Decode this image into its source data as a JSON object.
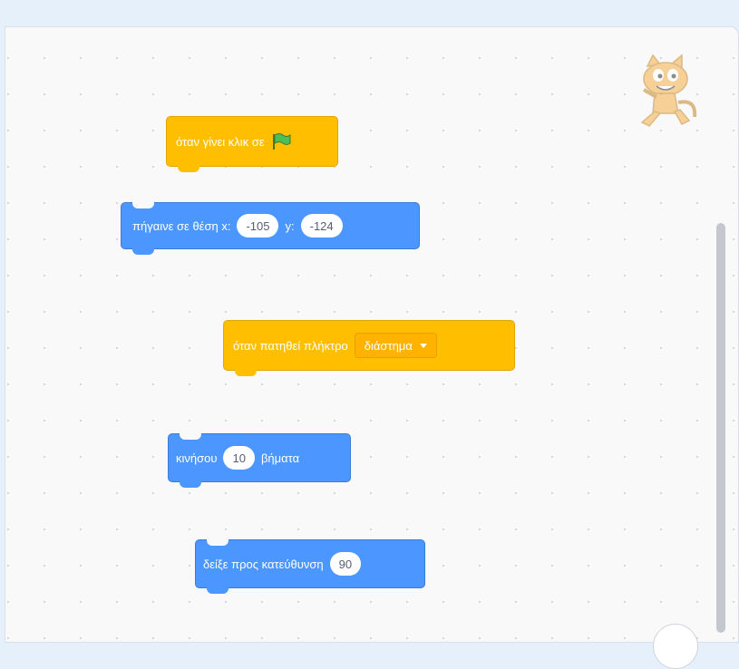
{
  "workspace": {
    "colors": {
      "motion": "#4c97ff",
      "event": "#ffbf00",
      "background": "#f9f9f9"
    },
    "sprite_icon": "scratch-cat-icon"
  },
  "blocks": {
    "when_flag": {
      "label": "όταν γίνει κλικ σε",
      "icon": "green-flag-icon"
    },
    "goto_xy": {
      "label": "πήγαινε σε θέση x:",
      "x_value": "-105",
      "y_label": "y:",
      "y_value": "-124"
    },
    "when_key": {
      "label": "όταν πατηθεί πλήκτρο",
      "key_value": "διάστημα"
    },
    "move": {
      "label": "κινήσου",
      "steps_value": "10",
      "suffix": "βήματα"
    },
    "point_direction": {
      "label": "δείξε προς κατεύθυνση",
      "direction_value": "90"
    }
  }
}
